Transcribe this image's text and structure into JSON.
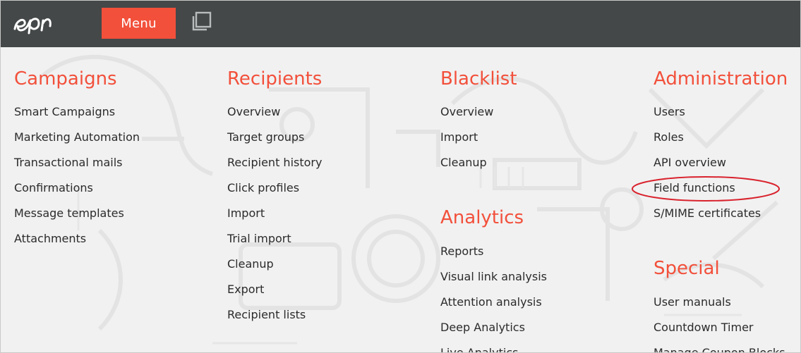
{
  "topbar": {
    "logo_icon": "episerver-logo",
    "menu_label": "Menu",
    "windows_icon": "window-switch-icon",
    "background_color": "#444849",
    "accent_color": "#f2503b"
  },
  "columns": [
    {
      "heading": "Campaigns",
      "items": [
        "Smart Campaigns",
        "Marketing Automation",
        "Transactional mails",
        "Confirmations",
        "Message templates",
        "Attachments"
      ]
    },
    {
      "heading": "Recipients",
      "items": [
        "Overview",
        "Target groups",
        "Recipient history",
        "Click profiles",
        "Import",
        "Trial import",
        "Cleanup",
        "Export",
        "Recipient lists"
      ]
    },
    {
      "heading": "Blacklist",
      "items": [
        "Overview",
        "Import",
        "Cleanup"
      ],
      "heading2": "Analytics",
      "items2": [
        "Reports",
        "Visual link analysis",
        "Attention analysis",
        "Deep Analytics",
        "Live Analytics"
      ]
    },
    {
      "heading": "Administration",
      "items": [
        "Users",
        "Roles",
        "API overview",
        "Field functions",
        "S/MIME certificates"
      ],
      "heading2": "Special",
      "items2": [
        "User manuals",
        "Countdown Timer",
        "Manage Coupon Blocks"
      ]
    }
  ],
  "annotation": {
    "highlighted_item": "Field functions",
    "ellipse_color": "#d9232e"
  }
}
